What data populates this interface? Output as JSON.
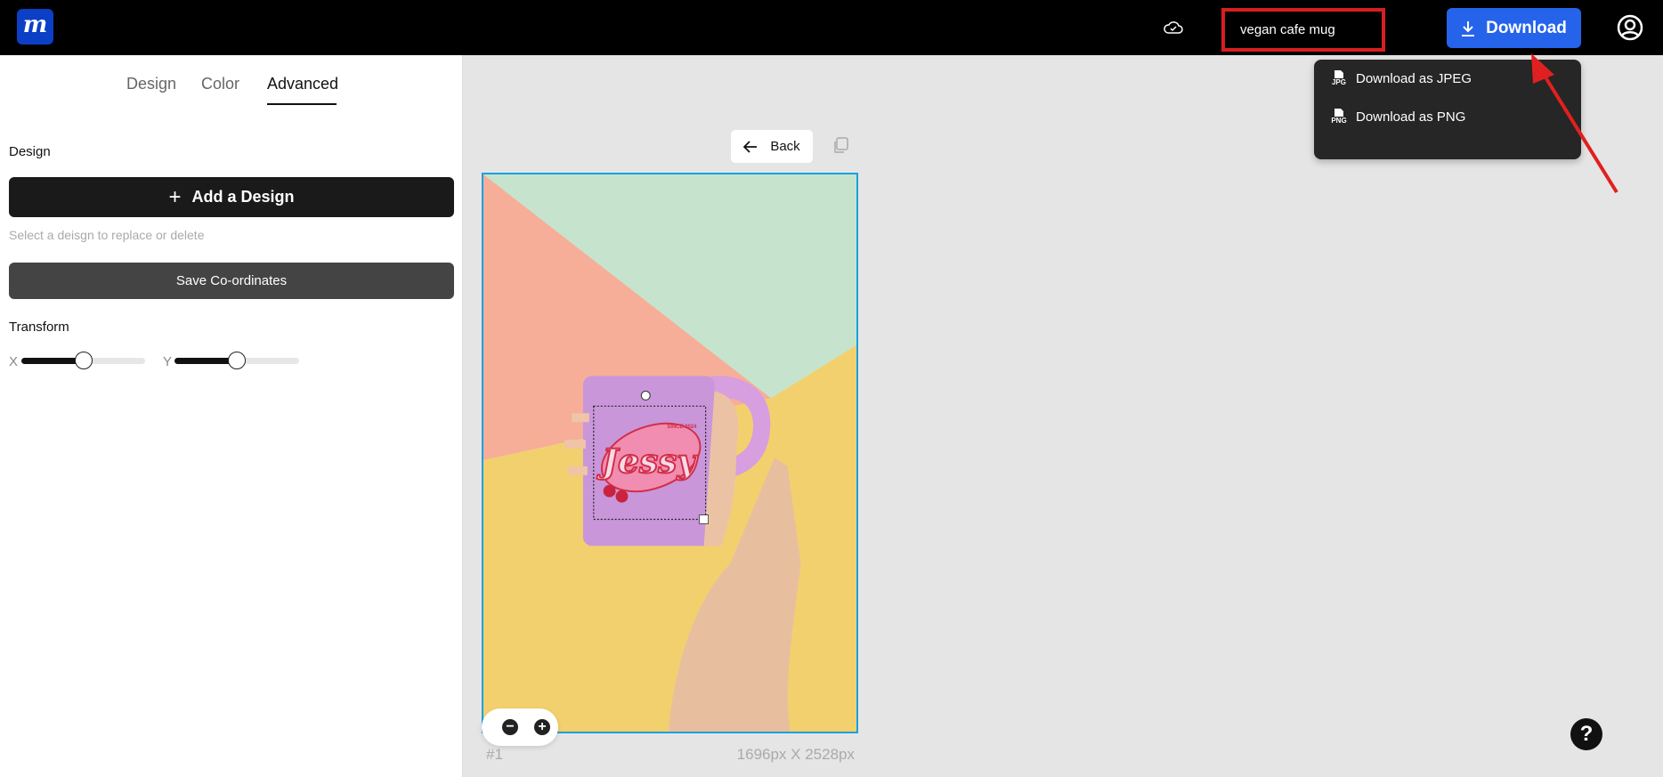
{
  "header": {
    "logo_letter": "m",
    "project_name": "vegan cafe mug",
    "download_label": "Download",
    "icons": {
      "save_status": "cloud-check-icon",
      "account": "user-circle-icon"
    }
  },
  "download_menu": {
    "items": [
      {
        "label": "Download as JPEG",
        "icon": "jpg-file-icon",
        "icon_text": "JPG"
      },
      {
        "label": "Download as PNG",
        "icon": "png-file-icon",
        "icon_text": "PNG"
      }
    ]
  },
  "sidebar": {
    "tabs": [
      {
        "label": "Design",
        "active": false
      },
      {
        "label": "Color",
        "active": false
      },
      {
        "label": "Advanced",
        "active": true
      }
    ],
    "design_label": "Design",
    "add_design_label": "Add a Design",
    "hint": "Select a deisgn to replace or delete",
    "save_label": "Save Co-ordinates",
    "transform_label": "Transform",
    "sliders": [
      {
        "label": "X",
        "value_percent": 50
      },
      {
        "label": "Y",
        "value_percent": 50
      }
    ]
  },
  "canvas": {
    "back_label": "Back",
    "page_number": "#1",
    "dimensions": "1696px X 2528px",
    "artwork": {
      "main_text": "Jessy",
      "sub_text": "SINCE 2024"
    },
    "zoom_out": "−",
    "zoom_in": "+"
  },
  "help_label": "?",
  "colors": {
    "accent": "#2563eb",
    "highlight": "#d81e1e",
    "selection": "#1aa0e0"
  }
}
